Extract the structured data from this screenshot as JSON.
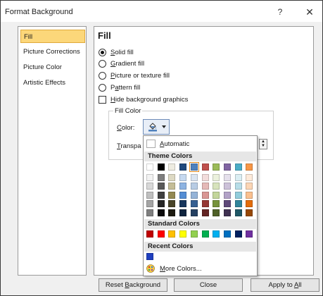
{
  "window": {
    "title": "Format Background",
    "help": "?",
    "close": "✕"
  },
  "nav": [
    {
      "label": "Fill",
      "selected": true
    },
    {
      "label": "Picture Corrections",
      "selected": false
    },
    {
      "label": "Picture Color",
      "selected": false
    },
    {
      "label": "Artistic Effects",
      "selected": false
    }
  ],
  "fill": {
    "heading": "Fill",
    "options": {
      "solid": {
        "pre": "",
        "key": "S",
        "post": "olid fill",
        "checked": true
      },
      "gradient": {
        "pre": "",
        "key": "G",
        "post": "radient fill",
        "checked": false
      },
      "picture": {
        "pre": "",
        "key": "P",
        "post": "icture or texture fill",
        "checked": false
      },
      "pattern": {
        "pre": "P",
        "key": "a",
        "post": "ttern fill",
        "checked": false
      }
    },
    "hide_graphics": {
      "pre": "",
      "key": "H",
      "post": "ide background graphics",
      "checked": false
    },
    "fill_color_legend": "Fill Color",
    "color_label": {
      "pre": "",
      "key": "C",
      "post": "olor:"
    },
    "transparency_label": {
      "pre": "",
      "key": "T",
      "post": "ranspa"
    }
  },
  "palette": {
    "automatic": {
      "pre": "",
      "key": "A",
      "post": "utomatic"
    },
    "theme_heading": "Theme Colors",
    "theme_top": [
      "#FFFFFF",
      "#000000",
      "#EEECE1",
      "#1F497D",
      "#4F81BD",
      "#C0504D",
      "#9BBB59",
      "#8064A2",
      "#4BACC6",
      "#F79646"
    ],
    "theme_selected_index": 4,
    "theme_shades": [
      [
        "#F2F2F2",
        "#7F7F7F",
        "#DDD9C3",
        "#C6D9F0",
        "#DBE5F1",
        "#F2DCDB",
        "#EBF1DD",
        "#E5E0EC",
        "#DBEEF3",
        "#FDEADA"
      ],
      [
        "#D8D8D8",
        "#595959",
        "#C4BD97",
        "#8DB3E2",
        "#B8CCE4",
        "#E5B9B7",
        "#D7E3BC",
        "#CCC1D9",
        "#B7DDE8",
        "#FBD5B5"
      ],
      [
        "#BFBFBF",
        "#3F3F3F",
        "#938953",
        "#548DD4",
        "#95B3D7",
        "#D99694",
        "#C3D69B",
        "#B2A2C7",
        "#92CDDC",
        "#FAC08F"
      ],
      [
        "#A5A5A5",
        "#262626",
        "#494429",
        "#17365D",
        "#366092",
        "#953734",
        "#76923C",
        "#5F497A",
        "#31859B",
        "#E36C09"
      ],
      [
        "#7F7F7F",
        "#0C0C0C",
        "#1D1B10",
        "#0F243E",
        "#244061",
        "#632423",
        "#4F6128",
        "#3F3151",
        "#205867",
        "#974806"
      ]
    ],
    "standard_heading": "Standard Colors",
    "standard": [
      "#C00000",
      "#FF0000",
      "#FFC000",
      "#FFFF00",
      "#92D050",
      "#00B050",
      "#00B0F0",
      "#0070C0",
      "#002060",
      "#7030A0"
    ],
    "recent_heading": "Recent Colors",
    "recent": [
      "#1F3FBF"
    ],
    "more_colors": {
      "pre": "",
      "key": "M",
      "post": "ore Colors..."
    }
  },
  "buttons": {
    "reset": {
      "pre": "Reset ",
      "key": "B",
      "post": "ackground"
    },
    "close": "Close",
    "apply_all": {
      "pre": "Apply to ",
      "key": "A",
      "post": "ll"
    }
  }
}
